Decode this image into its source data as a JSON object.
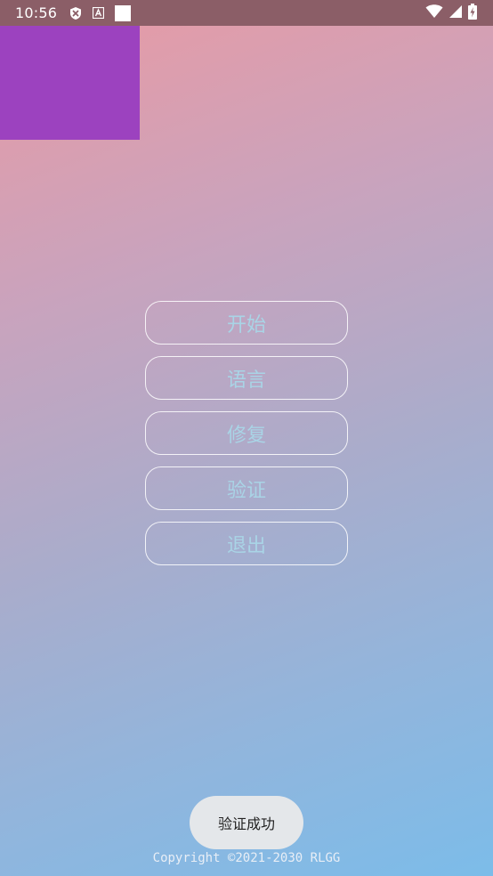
{
  "status_bar": {
    "time": "10:56",
    "icons": [
      "shield-x-icon",
      "font-a-icon",
      "white-square-icon"
    ],
    "right_icons": [
      "wifi-icon",
      "signal-icon",
      "battery-charging-icon"
    ]
  },
  "menu": {
    "buttons": [
      {
        "label": "开始"
      },
      {
        "label": "语言"
      },
      {
        "label": "修复"
      },
      {
        "label": "验证"
      },
      {
        "label": "退出"
      }
    ]
  },
  "toast": {
    "text": "验证成功"
  },
  "footer": {
    "copyright": "Copyright ©2021-2030 RLGG"
  },
  "colors": {
    "status_bar": "#8b5e67",
    "purple_block": "#9c42bf",
    "button_text": "#a9d4e6",
    "toast_bg": "#e4e7ea"
  }
}
